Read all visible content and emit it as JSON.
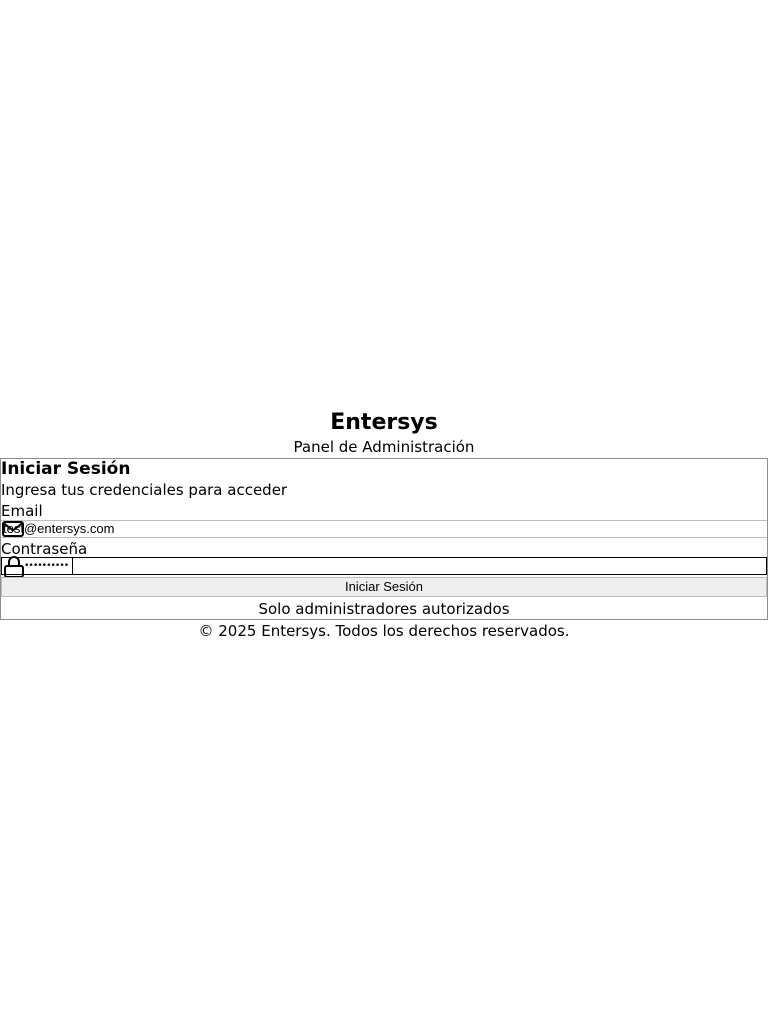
{
  "brand": {
    "title": "Entersys",
    "subtitle": "Panel de Administración"
  },
  "login_card": {
    "title": "Iniciar Sesión",
    "description": "Ingresa tus credenciales para acceder",
    "email": {
      "label": "Email",
      "value": "test@entersys.com",
      "icon": "mail-icon"
    },
    "password": {
      "label": "Contraseña",
      "value": "••••••••••",
      "icon": "lock-icon"
    },
    "submit_label": "Iniciar Sesión",
    "note": "Solo administradores autorizados"
  },
  "footer": {
    "text": "© 2025 Entersys. Todos los derechos reservados."
  }
}
